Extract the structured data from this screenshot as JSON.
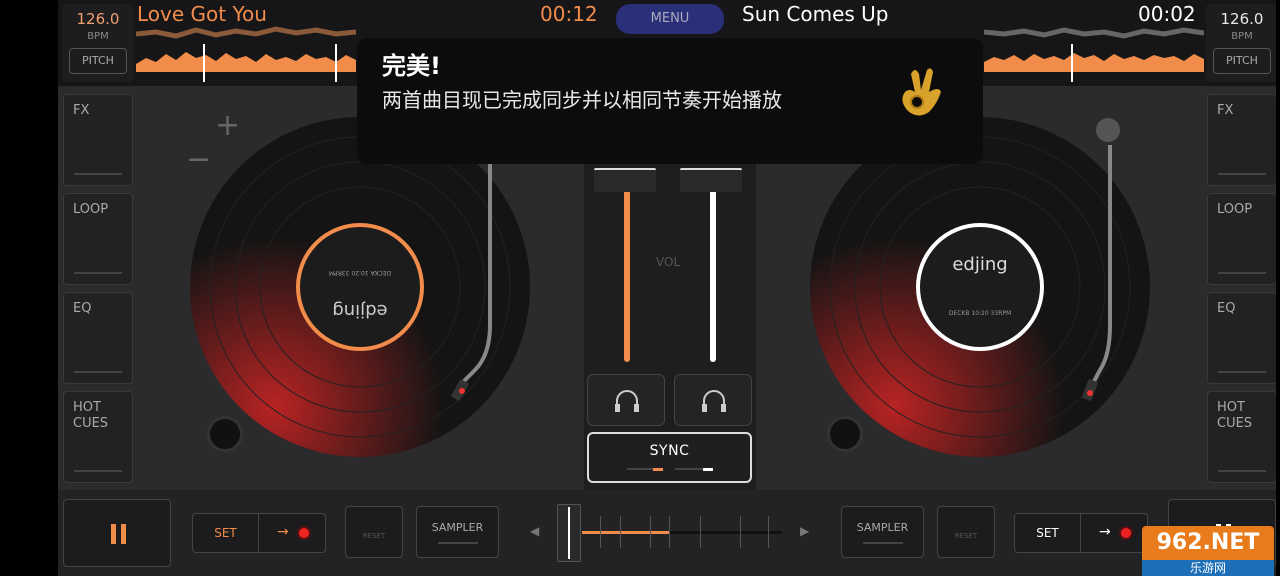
{
  "left_deck": {
    "bpm": "126.0",
    "bpm_label": "BPM",
    "pitch_label": "PITCH",
    "track_title": "Love Got You",
    "time": "00:12",
    "accent_color": "#f28c4a",
    "side_buttons": [
      "FX",
      "LOOP",
      "EQ",
      "HOT\nCUES"
    ],
    "record_brand": "edjing",
    "record_deck_text": "DECKA 10:20 33RPM"
  },
  "right_deck": {
    "bpm": "126.0",
    "bpm_label": "BPM",
    "pitch_label": "PITCH",
    "track_title": "Sun Comes Up",
    "time": "00:02",
    "accent_color": "#ffffff",
    "side_buttons": [
      "FX",
      "LOOP",
      "EQ",
      "HOT\nCUES"
    ],
    "record_brand": "edjing",
    "record_deck_text": "DECKB 10:20 33RPM"
  },
  "menu_label": "MENU",
  "mixer": {
    "vol_label": "VOL",
    "sync_label": "SYNC",
    "left_volume": 0.85,
    "right_volume": 0.85
  },
  "toast": {
    "title": "完美!",
    "message": "两首曲目现已完成同步并以相同节奏开始播放",
    "emoji": "ok-hand-emoji"
  },
  "bottom": {
    "set_label": "SET",
    "reset_label": "RESET",
    "sampler_label": "SAMPLER",
    "crossfader_position": 0.0
  },
  "watermark": {
    "brand": "962.NET",
    "sub": "乐游网"
  },
  "colors": {
    "orange": "#f28c4a",
    "background": "#2b2b2d",
    "red_glow": "#ff2a2a"
  }
}
